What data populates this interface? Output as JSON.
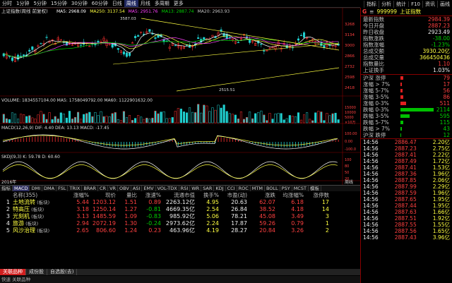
{
  "toolbar": {
    "items": [
      "分时",
      "1分钟",
      "5分钟",
      "15分钟",
      "30分钟",
      "60分钟",
      "日线",
      "周线",
      "月线",
      "多周期",
      "更多"
    ],
    "active_index": 7,
    "right_items": [
      "指标",
      "分析",
      "统计",
      "F10",
      "资讯",
      "画线"
    ]
  },
  "chart": {
    "title": "上证指数(周线 前复权)",
    "ma_labels": [
      {
        "text": "MA5: 2968.09",
        "color": "#ffffff"
      },
      {
        "text": "MA250: 3137.54",
        "color": "#ffff40"
      },
      {
        "text": "MA5: 2951.76",
        "color": "#ff40ff"
      },
      {
        "text": "MA13: 2887.74",
        "color": "#00d000"
      },
      {
        "text": "MA20: 2963.93",
        "color": "#c0c0c0"
      }
    ],
    "high_label": "3587.03",
    "low_label": "2515.51",
    "price_ticks": [
      "3268",
      "3134",
      "3000",
      "2866",
      "2732",
      "2598",
      "2418"
    ],
    "volume_label": "VOLUME: 1834557104.00  MA5: 1758049792.00  MA60: 1122901632.00",
    "volume_ticks": [
      "15000",
      "10000",
      "5000",
      "×10万"
    ],
    "macd_label": "MACD(12,26,9)  DIF: 4.40  DEA: 13.13  MACD: -17.45",
    "macd_ticks": [
      "100.00",
      "0.00",
      "-100.0"
    ],
    "kdj_label": "SKDJ(9,3)  K: 59.78  D: 60.60",
    "kdj_ticks": [
      "100",
      "80",
      "50",
      "20"
    ],
    "date_label": "2016年",
    "sidebar_btn": "周线"
  },
  "indicator_tabs": [
    "指标",
    "MACD",
    "DMI",
    "DMA",
    "FSL",
    "TRIX",
    "BRAR",
    "CR",
    "VR",
    "OBV",
    "ASI",
    "EMV",
    "VOL-TDX",
    "RSI",
    "WR",
    "SAR",
    "KDJ",
    "CCI",
    "ROC",
    "MTM",
    "BOLL",
    "PSY",
    "MCST",
    "模板"
  ],
  "table": {
    "headers": [
      "",
      "名称(355)",
      "涨幅%",
      "现价",
      "量比",
      "涨速%",
      "流通市值",
      "换手%",
      "市盈(动)",
      "涨跌",
      "均涨幅%",
      "涨停数"
    ],
    "rows": [
      {
        "idx": "1",
        "name": "土地流转",
        "tag": "(板块)",
        "pct": "5.44",
        "price": "1203.12",
        "vr": "1.51",
        "spd": "0.89",
        "mcap": "2263.12亿",
        "turn": "4.95",
        "pe": "20.63",
        "chg": "62.07",
        "avg": "6.18",
        "lim": "17"
      },
      {
        "idx": "2",
        "name": "特高压",
        "tag": "(板块)",
        "pct": "3.18",
        "price": "1250.14",
        "vr": "1.27",
        "spd": "-0.81",
        "mcap": "4669.35亿",
        "turn": "2.54",
        "pe": "26.84",
        "chg": "38.52",
        "avg": "4.18",
        "lim": "14"
      },
      {
        "idx": "3",
        "name": "光刻机",
        "tag": "(板块)",
        "pct": "3.13",
        "price": "1485.59",
        "vr": "1.09",
        "spd": "-0.83",
        "mcap": "985.92亿",
        "turn": "5.06",
        "pe": "78.21",
        "chg": "45.08",
        "avg": "3.49",
        "lim": "3"
      },
      {
        "idx": "4",
        "name": "旅游",
        "tag": "(板块)",
        "pct": "2.94",
        "price": "2072.19",
        "vr": "1.30",
        "spd": "-0.24",
        "mcap": "2973.62亿",
        "turn": "2.24",
        "pe": "17.87",
        "chg": "59.26",
        "avg": "0.79",
        "lim": "1"
      },
      {
        "idx": "5",
        "name": "风沙治理",
        "tag": "(板块)",
        "pct": "2.65",
        "price": "806.60",
        "vr": "1.24",
        "spd": "0.23",
        "mcap": "463.96亿",
        "turn": "4.19",
        "pe": "28.27",
        "chg": "20.84",
        "avg": "3.26",
        "lim": "2"
      }
    ]
  },
  "bottom_tabs": [
    "关联品种",
    "成份股",
    "自选股(去)"
  ],
  "status": "快速  关联品种",
  "quote": {
    "code": "999999",
    "name": "上证指数",
    "items": [
      {
        "k": "最新指数",
        "v": "2984.39",
        "c": "red"
      },
      {
        "k": "今日开盘",
        "v": "2887.23",
        "c": "red"
      },
      {
        "k": "昨日收盘",
        "v": "2923.49",
        "c": "white"
      },
      {
        "k": "指数涨跌",
        "v": "-38.00",
        "c": "green"
      },
      {
        "k": "指数涨幅",
        "v": "-1.23%",
        "c": "green"
      },
      {
        "k": "总成交额",
        "v": "3930.20亿",
        "c": "yellow"
      },
      {
        "k": "总成交量",
        "v": "366450436",
        "c": "yellow"
      },
      {
        "k": "指数量比",
        "v": "1.10",
        "c": "red"
      },
      {
        "k": "上证换手",
        "v": "1.03%",
        "c": "white"
      }
    ],
    "breadth": [
      {
        "k": "沪深 涨停",
        "v": "79",
        "c": "red",
        "bar": 0.08
      },
      {
        "k": "涨幅 > 7%",
        "v": "17",
        "c": "red",
        "bar": 0.04
      },
      {
        "k": "涨幅 5-7%",
        "v": "56",
        "c": "red",
        "bar": 0.06
      },
      {
        "k": "涨幅 3-5%",
        "v": "86",
        "c": "red",
        "bar": 0.08
      },
      {
        "k": "涨幅 0-3%",
        "v": "511",
        "c": "red",
        "bar": 0.15
      },
      {
        "k": "跌幅 0-3%",
        "v": "2114",
        "c": "green",
        "bar": 0.9
      },
      {
        "k": "跌幅 3-5%",
        "v": "595",
        "c": "green",
        "bar": 0.25
      },
      {
        "k": "跌幅 5-7%",
        "v": "115",
        "c": "green",
        "bar": 0.08
      },
      {
        "k": "跌幅 > 7%",
        "v": "43",
        "c": "green",
        "bar": 0.04
      },
      {
        "k": "沪深 跌停",
        "v": "12",
        "c": "green",
        "bar": 0.02
      }
    ],
    "ticks": [
      {
        "t": "14:56",
        "p": "2886.47",
        "v": "2.20亿"
      },
      {
        "t": "14:56",
        "p": "2887.23",
        "v": "2.75亿"
      },
      {
        "t": "14:56",
        "p": "2887.41",
        "v": "2.22亿"
      },
      {
        "t": "14:56",
        "p": "2887.49",
        "v": "1.72亿"
      },
      {
        "t": "14:56",
        "p": "2887.41",
        "v": "1.53亿"
      },
      {
        "t": "14:56",
        "p": "2887.36",
        "v": "1.96亿"
      },
      {
        "t": "14:56",
        "p": "2887.85",
        "v": "2.06亿"
      },
      {
        "t": "14:56",
        "p": "2887.99",
        "v": "2.29亿"
      },
      {
        "t": "14:56",
        "p": "2887.59",
        "v": "1.96亿"
      },
      {
        "t": "14:56",
        "p": "2887.65",
        "v": "1.95亿"
      },
      {
        "t": "14:56",
        "p": "2887.44",
        "v": "1.95亿"
      },
      {
        "t": "14:56",
        "p": "2887.63",
        "v": "1.66亿"
      },
      {
        "t": "14:56",
        "p": "2887.51",
        "v": "1.92亿"
      },
      {
        "t": "14:56",
        "p": "2887.55",
        "v": "1.55亿"
      },
      {
        "t": "14:56",
        "p": "2887.56",
        "v": "1.65亿"
      },
      {
        "t": "14:56",
        "p": "2887.43",
        "v": "3.96亿"
      }
    ]
  }
}
